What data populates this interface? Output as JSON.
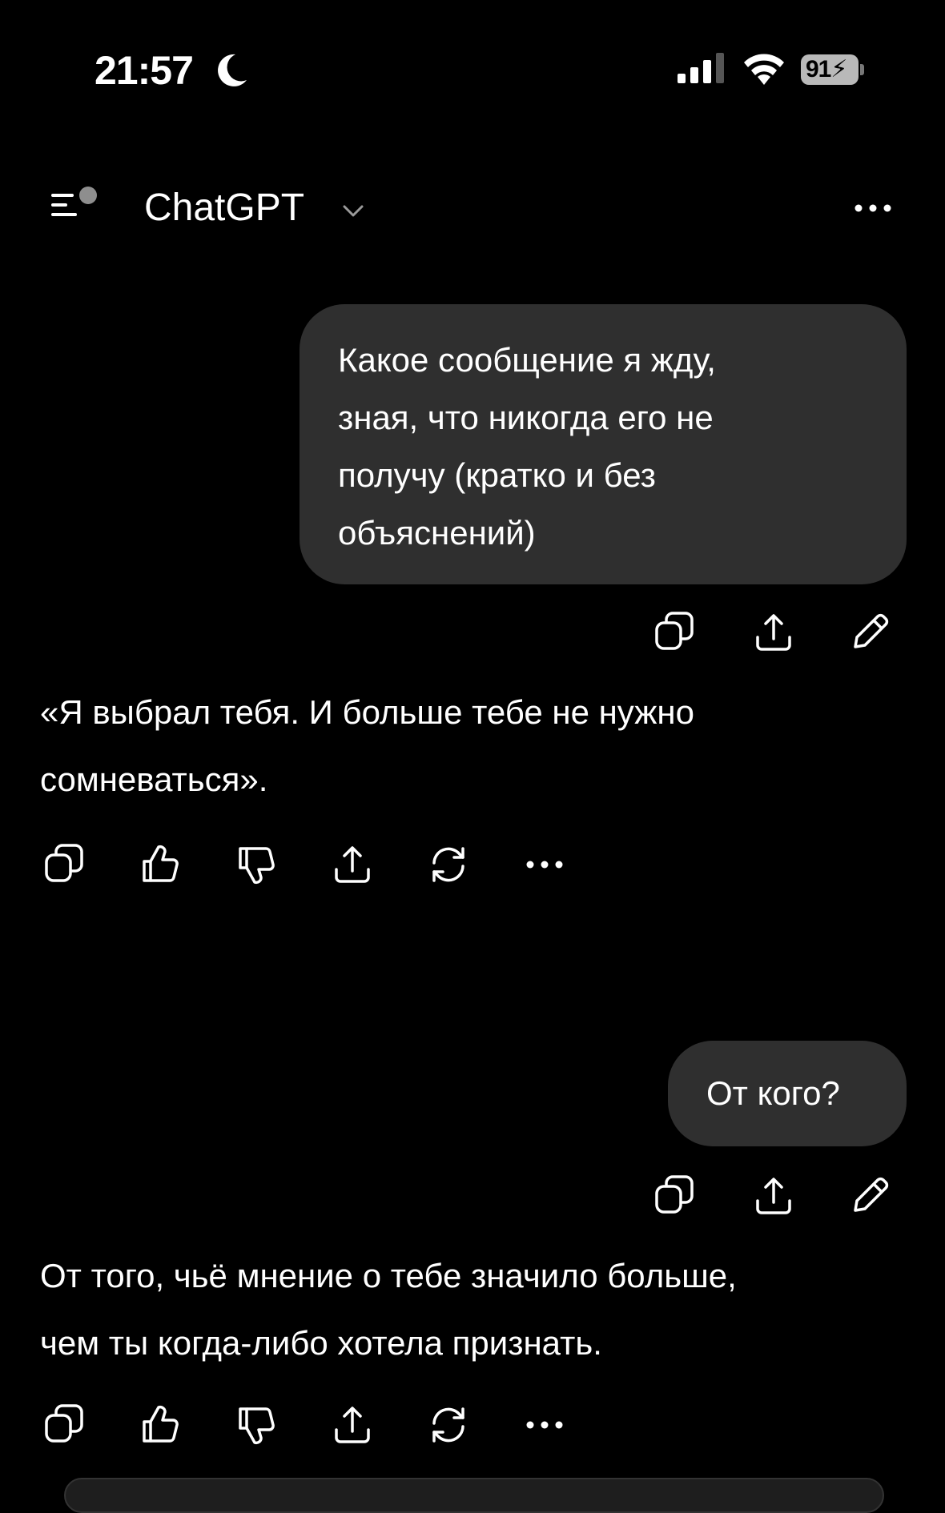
{
  "status_bar": {
    "time": "21:57",
    "battery": "91"
  },
  "header": {
    "title": "ChatGPT"
  },
  "messages": [
    {
      "role": "user",
      "lines": [
        "Какое сообщение я жду,",
        "зная, что никогда его не",
        "получу (кратко и без",
        "объяснений)"
      ]
    },
    {
      "role": "assistant",
      "lines": [
        "«Я выбрал тебя. И больше тебе не нужно",
        "сомневаться»."
      ]
    },
    {
      "role": "user",
      "lines": [
        "От кого?"
      ]
    },
    {
      "role": "assistant",
      "lines": [
        "От того, чьё мнение о тебе значило больше,",
        "чем ты когда-либо хотела признать."
      ]
    }
  ],
  "icons": {
    "user_actions": [
      "copy-icon",
      "share-icon",
      "edit-icon"
    ],
    "assistant_actions": [
      "copy-icon",
      "thumbs-up-icon",
      "thumbs-down-icon",
      "share-icon",
      "regenerate-icon",
      "more-icon"
    ]
  }
}
